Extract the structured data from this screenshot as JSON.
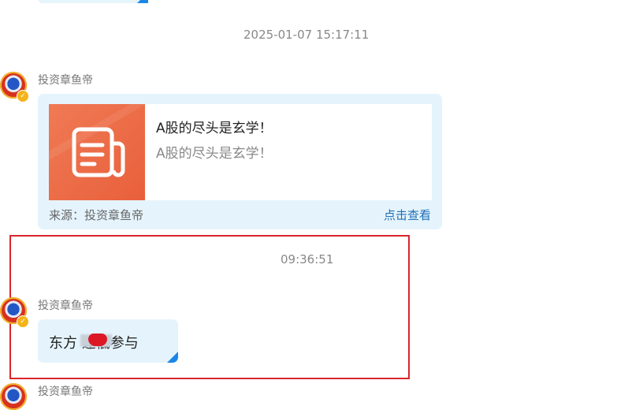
{
  "previous_message": {
    "corner_color": "#1c86e8"
  },
  "timestamps": {
    "first": "2025-01-07 15:17:11",
    "second": "09:36:51"
  },
  "messages": [
    {
      "sender": "投资章鱼帝",
      "avatar_icon": "globe-avatar-icon",
      "type": "card",
      "card": {
        "title": "A股的尽头是玄学！",
        "description": "A股的尽头是玄学！",
        "thumbnail_icon": "article-icon",
        "source": "来源：投资章鱼帝",
        "link_label": "点击查看"
      }
    },
    {
      "sender": "投资章鱼帝",
      "avatar_icon": "globe-avatar-icon",
      "type": "text",
      "text": "东方        逢低参与"
    },
    {
      "sender": "投资章鱼帝",
      "avatar_icon": "globe-avatar-icon",
      "type": "partial"
    }
  ],
  "colors": {
    "bubble": "#e5f4fc",
    "highlight": "#d9262c",
    "link": "#1f6fb5",
    "thumbnail": "#ea6a45"
  }
}
